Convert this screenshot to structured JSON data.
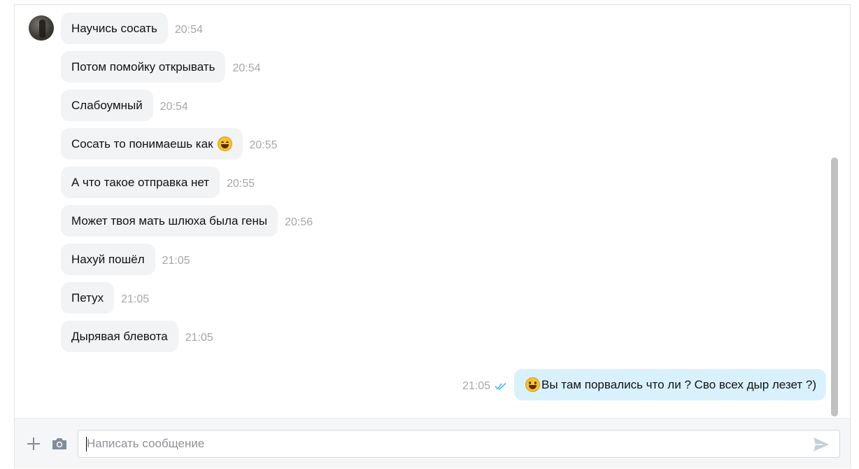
{
  "chat": {
    "incoming": [
      {
        "text": "Научись сосать",
        "time": "20:54"
      },
      {
        "text": "Потом помойку открывать",
        "time": "20:54"
      },
      {
        "text": "Слабоумный",
        "time": "20:54"
      },
      {
        "text": "Сосать то понимаешь как",
        "time": "20:55",
        "emoji": "laughing-emoji"
      },
      {
        "text": "А что такое отправка нет",
        "time": "20:55"
      },
      {
        "text": "Может твоя мать шлюха была гены",
        "time": "20:56"
      },
      {
        "text": "Нахуй пошёл",
        "time": "21:05"
      },
      {
        "text": "Петух",
        "time": "21:05"
      },
      {
        "text": "Дырявая блевота",
        "time": "21:05"
      }
    ],
    "outgoing": {
      "text": "Вы там порвались что ли ? Сво всех дыр лезет ?)",
      "time": "21:05",
      "emoji": "grinning-emoji",
      "status_icon": "double-check-icon"
    }
  },
  "composer": {
    "placeholder": "Написать сообщение",
    "value": "",
    "icons": [
      "plus-icon",
      "camera-icon",
      "send-icon"
    ]
  },
  "colors": {
    "incoming_bubble": "#f2f3f5",
    "outgoing_bubble": "#d9f1fd",
    "timestamp": "#a4a7ab",
    "read_check": "#4bb3fd"
  }
}
